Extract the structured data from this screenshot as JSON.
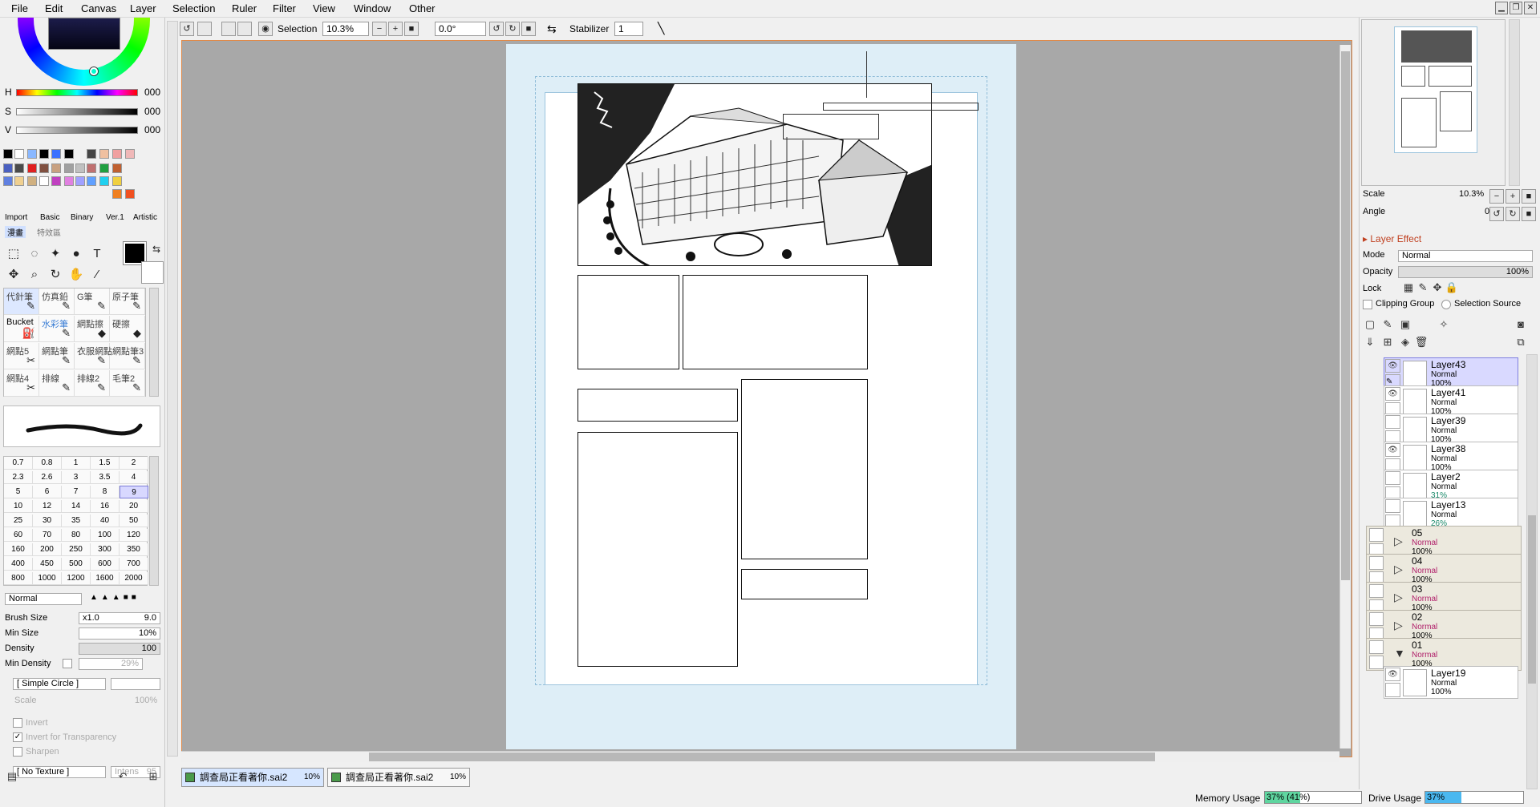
{
  "menu": [
    "File",
    "Edit",
    "Canvas",
    "Layer",
    "Selection",
    "Ruler",
    "Filter",
    "View",
    "Window",
    "Other"
  ],
  "window_controls": {
    "minimize": "▁",
    "restore": "❐",
    "close": "✕"
  },
  "color": {
    "h_label": "H",
    "h_value": "000",
    "s_label": "S",
    "s_value": "000",
    "v_label": "V",
    "v_value": "000"
  },
  "palette_tabs": [
    "Import",
    "Basic",
    "Binary",
    "Ver.1",
    "Artistic"
  ],
  "palette_tabs2": [
    "漫畫",
    "特效區"
  ],
  "brushes": [
    {
      "name": "代針筆",
      "icon": "✎"
    },
    {
      "name": "仿真鉛",
      "icon": "✎"
    },
    {
      "name": "G筆",
      "icon": "✎"
    },
    {
      "name": "原子筆",
      "icon": "✎"
    },
    {
      "name": "Bucket",
      "icon": "⛽"
    },
    {
      "name": "水彩筆",
      "icon": "✎"
    },
    {
      "name": "網點擦",
      "icon": "◆"
    },
    {
      "name": "硬擦",
      "icon": "◆"
    },
    {
      "name": "網點5",
      "icon": "✂"
    },
    {
      "name": "網點筆",
      "icon": "✎"
    },
    {
      "name": "衣服網點",
      "icon": "✎"
    },
    {
      "name": "網點筆3",
      "icon": "✎"
    },
    {
      "name": "網點4",
      "icon": "✂"
    },
    {
      "name": "排線",
      "icon": "✎"
    },
    {
      "name": "排線2",
      "icon": "✎"
    },
    {
      "name": "毛筆2",
      "icon": "✎"
    }
  ],
  "brush_sizes": [
    "0.7",
    "0.8",
    "1",
    "1.5",
    "2",
    "2.3",
    "2.6",
    "3",
    "3.5",
    "4",
    "5",
    "6",
    "7",
    "8",
    "9",
    "10",
    "12",
    "14",
    "16",
    "20",
    "25",
    "30",
    "35",
    "40",
    "50",
    "60",
    "70",
    "80",
    "100",
    "120",
    "160",
    "200",
    "250",
    "300",
    "350",
    "400",
    "450",
    "500",
    "600",
    "700",
    "800",
    "1000",
    "1200",
    "1600",
    "2000"
  ],
  "brush_settings": {
    "blend_mode": "Normal",
    "brush_size_label": "Brush Size",
    "brush_size_mult": "x1.0",
    "brush_size_value": "9.0",
    "min_size_label": "Min Size",
    "min_size_value": "10%",
    "density_label": "Density",
    "density_value": "100",
    "min_density_label": "Min Density",
    "min_density_value": "29%",
    "shape": "[ Simple Circle ]",
    "scale_label": "Scale",
    "scale_value": "100%",
    "invert_label": "Invert",
    "invert_transp_label": "Invert for Transparency",
    "sharpen_label": "Sharpen",
    "texture": "[ No Texture ]",
    "intens_label": "Intens",
    "intens_value": "95"
  },
  "toolbar": {
    "selection_label": "Selection",
    "zoom_value": "10.3%",
    "angle_value": "0.0°",
    "stabilizer_label": "Stabilizer",
    "stabilizer_value": "1"
  },
  "documents": [
    {
      "name": "調查局正看著你.sai2",
      "zoom": "10%"
    },
    {
      "name": "調查局正看著你.sai2",
      "zoom": "10%"
    }
  ],
  "status": {
    "memory_label": "Memory Usage",
    "memory_value": "37% (41%)",
    "memory_fill": 0.37,
    "drive_label": "Drive Usage",
    "drive_value": "37%",
    "drive_fill": 0.37
  },
  "navigator": {
    "scale_label": "Scale",
    "scale_value": "10.3%",
    "angle_label": "Angle",
    "angle_value": "0°"
  },
  "layer_panel": {
    "effect_label": "Layer Effect",
    "mode_label": "Mode",
    "mode_value": "Normal",
    "opacity_label": "Opacity",
    "opacity_value": "100%",
    "lock_label": "Lock",
    "clipping_label": "Clipping Group",
    "selection_source_label": "Selection Source"
  },
  "layers": [
    {
      "name": "Layer43",
      "mode": "Normal",
      "opacity": "100%",
      "visible": true,
      "selected": true
    },
    {
      "name": "Layer41",
      "mode": "Normal",
      "opacity": "100%",
      "visible": true,
      "selected": false
    },
    {
      "name": "Layer39",
      "mode": "Normal",
      "opacity": "100%",
      "visible": false,
      "selected": false
    },
    {
      "name": "Layer38",
      "mode": "Normal",
      "opacity": "100%",
      "visible": true,
      "selected": false
    },
    {
      "name": "Layer2",
      "mode": "Normal",
      "opacity": "31%",
      "visible": false,
      "selected": false
    },
    {
      "name": "Layer13",
      "mode": "Normal",
      "opacity": "26%",
      "visible": false,
      "selected": false
    }
  ],
  "folders": [
    {
      "name": "05",
      "mode": "Normal",
      "opacity": "100%",
      "expanded": false
    },
    {
      "name": "04",
      "mode": "Normal",
      "opacity": "100%",
      "expanded": false
    },
    {
      "name": "03",
      "mode": "Normal",
      "opacity": "100%",
      "expanded": false
    },
    {
      "name": "02",
      "mode": "Normal",
      "opacity": "100%",
      "expanded": false
    },
    {
      "name": "01",
      "mode": "Normal",
      "opacity": "100%",
      "expanded": true
    }
  ],
  "sub_layers": [
    {
      "name": "Layer19",
      "mode": "Normal",
      "opacity": "100%"
    }
  ],
  "colors": {
    "accent": "#3c7fd6",
    "selected_layer": "#d9d9ff",
    "folder_mode": "#b0206a",
    "opacity_green": "#1a8a6a"
  }
}
